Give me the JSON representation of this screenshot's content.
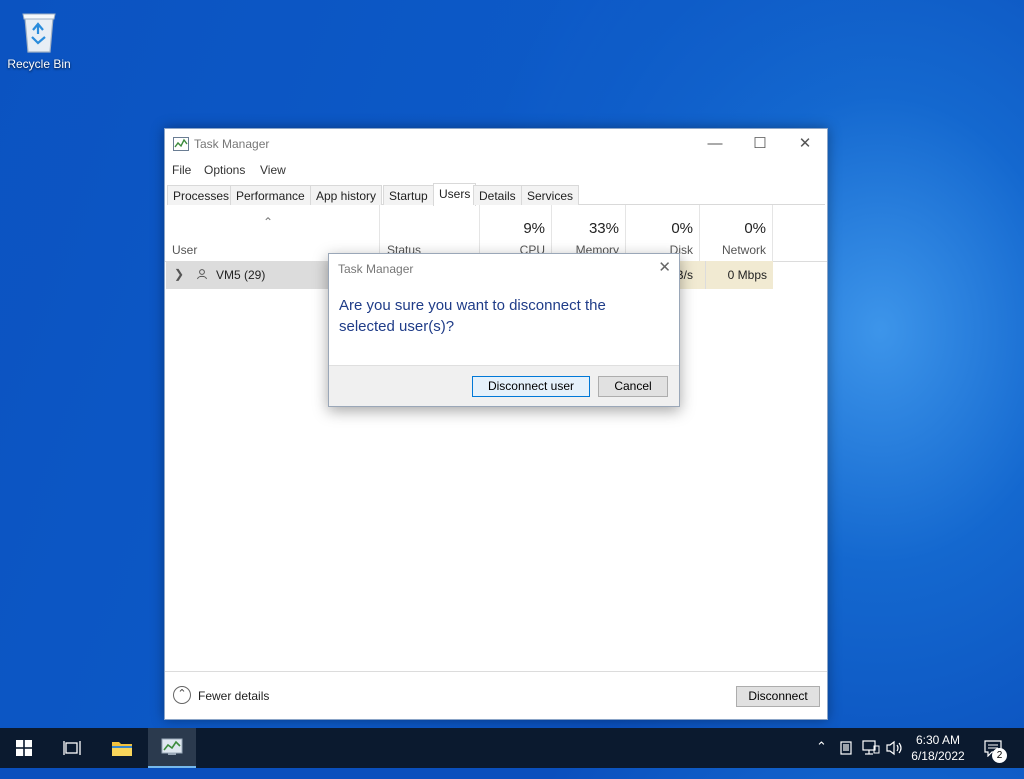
{
  "desktop": {
    "recycle_bin_label": "Recycle Bin"
  },
  "task_manager": {
    "title": "Task Manager",
    "menu": [
      "File",
      "Options",
      "View"
    ],
    "tabs": [
      "Processes",
      "Performance",
      "App history",
      "Startup",
      "Users",
      "Details",
      "Services"
    ],
    "active_tab": "Users",
    "columns": {
      "user": "User",
      "status": "Status",
      "cpu": {
        "pct": "9%",
        "name": "CPU"
      },
      "memory": {
        "pct": "33%",
        "name": "Memory"
      },
      "disk": {
        "pct": "0%",
        "name": "Disk"
      },
      "network": {
        "pct": "0%",
        "name": "Network"
      }
    },
    "rows": [
      {
        "user": "VM5 (29)",
        "disk": "B/s",
        "network": "0 Mbps"
      }
    ],
    "footer": {
      "fewer_details": "Fewer details",
      "disconnect": "Disconnect"
    }
  },
  "dialog": {
    "title": "Task Manager",
    "message": "Are you sure you want to disconnect the selected user(s)?",
    "confirm": "Disconnect user",
    "cancel": "Cancel"
  },
  "taskbar": {
    "time": "6:30 AM",
    "date": "6/18/2022",
    "notifications": "2"
  },
  "colors": {
    "accent": "#0078d7",
    "dialog_text": "#1f3c88",
    "taskbar": "#0b1a2f"
  }
}
